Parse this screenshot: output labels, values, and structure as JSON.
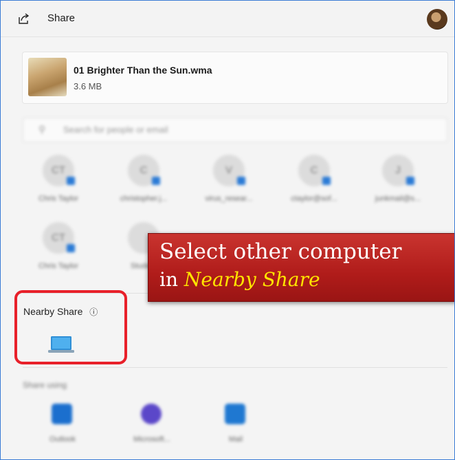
{
  "window": {
    "title": "Share"
  },
  "file": {
    "name": "01 Brighter Than the Sun.wma",
    "size": "3.6 MB"
  },
  "search": {
    "placeholder": "Search for people or email"
  },
  "contacts": [
    {
      "initials": "CT",
      "name": "Chris Taylor"
    },
    {
      "initials": "C",
      "name": "christopher.j..."
    },
    {
      "initials": "V",
      "name": "virus_resear..."
    },
    {
      "initials": "C",
      "name": "ctaylor@sof..."
    },
    {
      "initials": "J",
      "name": "junkmail@s..."
    },
    {
      "initials": "CT",
      "name": "Chris Taylor"
    },
    {
      "initials": "",
      "name": "Student"
    }
  ],
  "nearby": {
    "label": "Nearby Share",
    "info_icon": "info-icon",
    "device_icon": "laptop-icon"
  },
  "callout": {
    "line1": "Select other computer",
    "line2_prefix": "in",
    "line2_emphasis": "Nearby Share"
  },
  "share_using": {
    "label": "Share using",
    "apps": [
      {
        "name": "Outlook",
        "color": "#1b6fce"
      },
      {
        "name": "Microsoft...",
        "color": "#5b47c9"
      },
      {
        "name": "Mail",
        "color": "#1f78d1"
      }
    ]
  }
}
